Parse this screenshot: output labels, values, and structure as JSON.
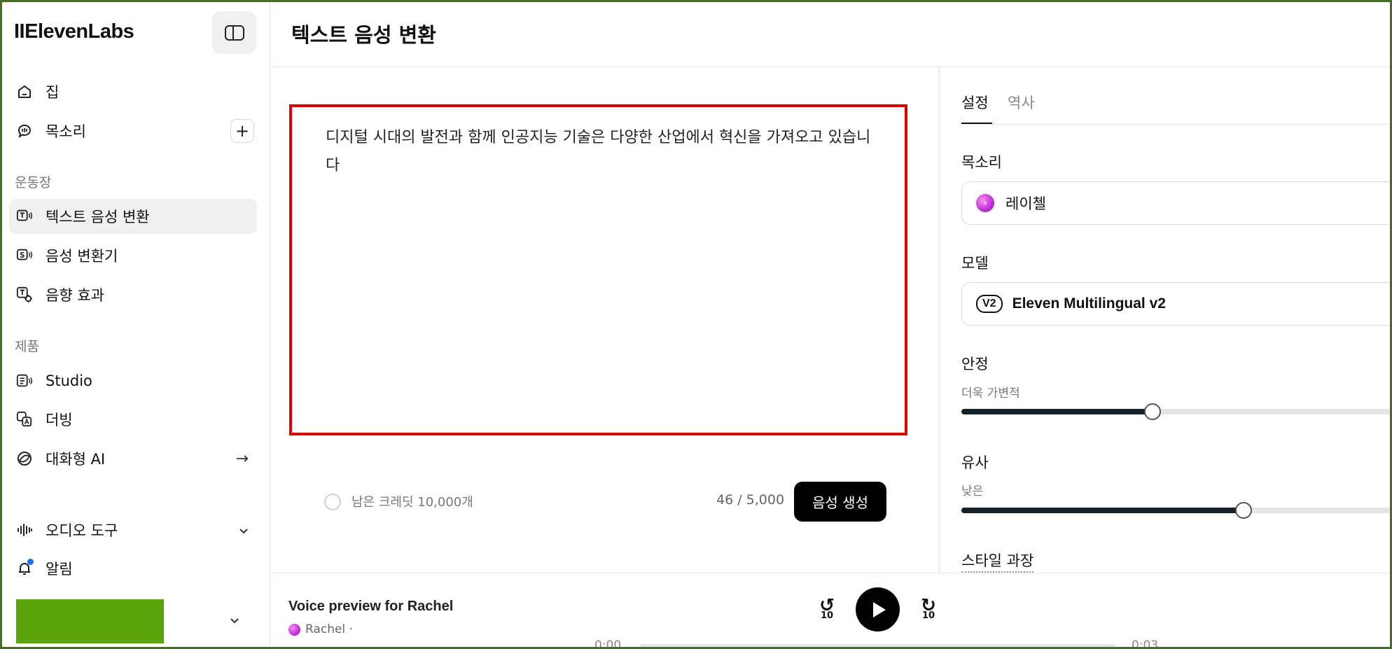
{
  "app": {
    "logo": "IIElevenLabs",
    "page_title": "텍스트 음성 변환"
  },
  "sidebar": {
    "items_top": [
      {
        "label": "집",
        "icon": "home-icon"
      },
      {
        "label": "목소리",
        "icon": "voice-bubble-icon",
        "trailing": "+"
      }
    ],
    "section_playground": "운동장",
    "playground": [
      {
        "label": "텍스트 음성 변환",
        "icon": "text-to-speech-icon",
        "active": true
      },
      {
        "label": "음성 변환기",
        "icon": "speech-to-speech-icon"
      },
      {
        "label": "음향 효과",
        "icon": "sound-effects-icon"
      }
    ],
    "section_products": "제품",
    "products": [
      {
        "label": "Studio",
        "icon": "studio-icon"
      },
      {
        "label": "더빙",
        "icon": "dubbing-icon"
      },
      {
        "label": "대화형 AI",
        "icon": "conversational-ai-icon",
        "trailing": "→"
      }
    ],
    "bottom": [
      {
        "label": "오디오 도구",
        "icon": "audio-wave-icon",
        "trailing": "⌄"
      },
      {
        "label": "알림",
        "icon": "bell-icon"
      }
    ]
  },
  "editor": {
    "text": "디지털 시대의 발전과 함께 인공지능 기술은 다양한 산업에서 혁신을 가져오고 있습니다",
    "credits": "남은 크레딧 10,000개",
    "char_count": "46 / 5,000",
    "generate_label": "음성 생성"
  },
  "settings": {
    "tab_settings": "설정",
    "tab_history": "역사",
    "voice_label": "목소리",
    "voice_value": "레이첼",
    "model_label": "모델",
    "model_badge": "V2",
    "model_value": "Eleven Multilingual v2",
    "stability_label": "안정",
    "stability_sub": "더욱 가변적",
    "stability_value": 0.441,
    "similarity_label": "유사",
    "similarity_sub": "낮은",
    "similarity_value": 0.652,
    "style_label": "스타일 과장"
  },
  "player": {
    "title": "Voice preview for Rachel",
    "voice": "Rachel ·",
    "skip_back": "10",
    "skip_forward": "10",
    "time_start": "0:00",
    "time_end": "0:03",
    "progress": 0
  },
  "colors": {
    "highlight_border": "#e00000",
    "account_block": "#5aa30a",
    "notification_dot": "#1a73e8"
  }
}
